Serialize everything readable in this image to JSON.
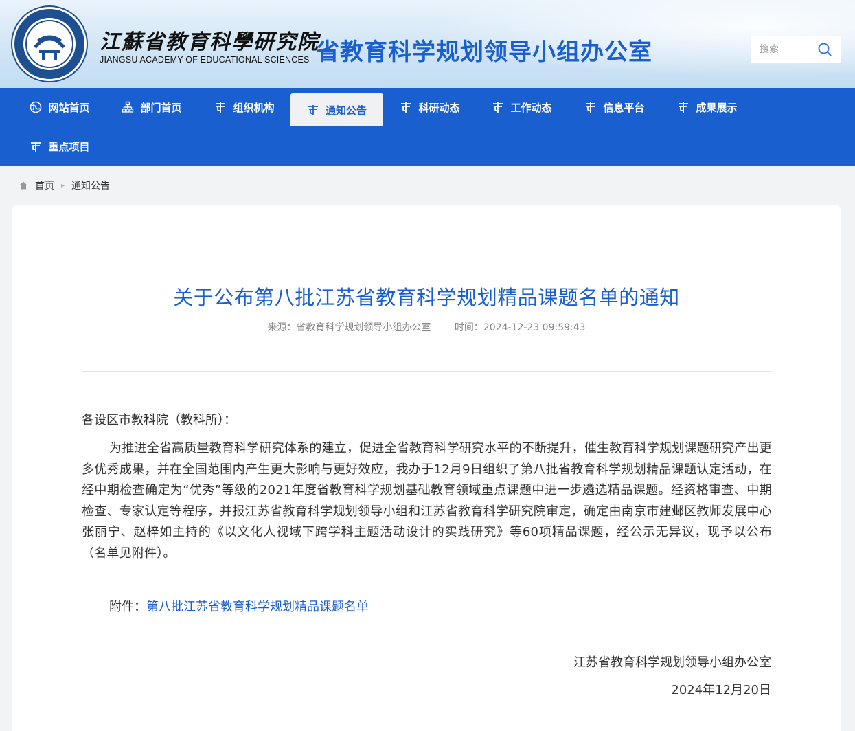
{
  "header": {
    "cn_name": "江蘇省教育科學研究院",
    "en_name": "JIANGSU ACADEMY OF EDUCATIONAL SCIENCES",
    "office_title": "省教育科学规划领导小组办公室",
    "search_placeholder": "搜索",
    "search_icon": "search-icon",
    "logo_icon": "academy-seal-logo"
  },
  "nav": {
    "items": [
      {
        "label": "网站首页",
        "icon": "globe-icon",
        "active": false
      },
      {
        "label": "部门首页",
        "icon": "sitemap-icon",
        "active": false
      },
      {
        "label": "组织机构",
        "icon": "pillar-icon",
        "active": false
      },
      {
        "label": "通知公告",
        "icon": "pillar-icon",
        "active": true
      },
      {
        "label": "科研动态",
        "icon": "pillar-icon",
        "active": false
      },
      {
        "label": "工作动态",
        "icon": "pillar-icon",
        "active": false
      },
      {
        "label": "信息平台",
        "icon": "pillar-icon",
        "active": false
      },
      {
        "label": "成果展示",
        "icon": "pillar-icon",
        "active": false
      },
      {
        "label": "重点项目",
        "icon": "pillar-icon",
        "active": false
      }
    ]
  },
  "breadcrumb": {
    "home": "首页",
    "current": "通知公告"
  },
  "article": {
    "title": "关于公布第八批江苏省教育科学规划精品课题名单的通知",
    "source_label": "来源：省教育科学规划领导小组办公室",
    "time_label": "时间：2024-12-23 09:59:43",
    "salutation": "各设区市教科院（教科所）：",
    "paragraph": "为推进全省高质量教育科学研究体系的建立，促进全省教育科学研究水平的不断提升，催生教育科学规划课题研究产出更多优秀成果，并在全国范围内产生更大影响与更好效应，我办于12月9日组织了第八批省教育科学规划精品课题认定活动，在经中期检查确定为“优秀”等级的2021年度省教育科学规划基础教育领域重点课题中进一步遴选精品课题。经资格审查、中期检查、专家认定等程序，并报江苏省教育科学规划领导小组和江苏省教育科学研究院审定，确定由南京市建邺区教师发展中心张丽宁、赵梓如主持的《以文化人视域下跨学科主题活动设计的实践研究》等60项精品课题，经公示无异议，现予以公布（名单见附件）。",
    "attachment_label": "附件：",
    "attachment_link": "第八批江苏省教育科学规划精品课题名单",
    "signature": "江苏省教育科学规划领导小组办公室",
    "date": "2024年12月20日"
  },
  "colors": {
    "brand_blue": "#1a5fd0",
    "nav_active_bg": "#f0f1f3"
  }
}
